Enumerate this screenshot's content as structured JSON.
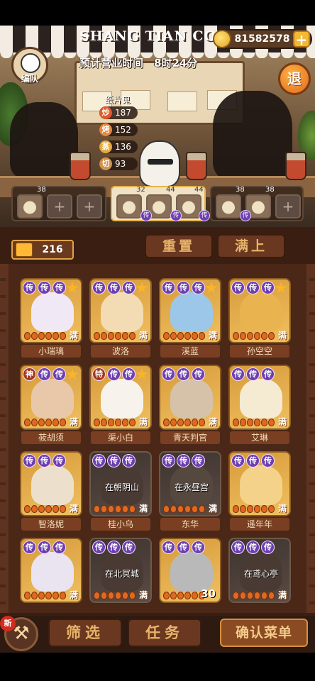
{
  "header": {
    "shop_name": "SHANG TIAN COF",
    "coins": "81582578",
    "coin_plus": "+"
  },
  "hours_text": "预计营业时间　8时24分",
  "team_label": "编队",
  "exit_label": "退",
  "chef": {
    "name": "纸片鬼",
    "stats": [
      {
        "tag": "炒",
        "value": "187",
        "color": "#e0592a"
      },
      {
        "tag": "烤",
        "value": "152",
        "color": "#e9863a"
      },
      {
        "tag": "蒸",
        "value": "136",
        "color": "#e5a93b"
      },
      {
        "tag": "切",
        "value": "93",
        "color": "#d4914a"
      }
    ]
  },
  "dish_groups": [
    {
      "num": "38",
      "plus1": "+",
      "plus2": "+"
    },
    {
      "nums": [
        "32",
        "44",
        "44"
      ],
      "badge": "传"
    },
    {
      "nums": [
        "38",
        "38"
      ],
      "plus": "+",
      "badge": "传"
    }
  ],
  "ticket_value": "216",
  "buttons": {
    "reset": "重置",
    "fill": "满上",
    "filter": "筛选",
    "task": "任务",
    "confirm": "确认菜单",
    "new": "新",
    "hammer": "⚒"
  },
  "cards": [
    {
      "name": "小瑞璃",
      "badges": [
        "传",
        "传",
        "传"
      ],
      "star": true,
      "full": "满",
      "pips": 6,
      "dim": false,
      "portrait": "#f1e8f6"
    },
    {
      "name": "波洛",
      "badges": [
        "传",
        "传",
        "传"
      ],
      "star": true,
      "full": "满",
      "pips": 6,
      "dim": false,
      "portrait": "#f3dcb3"
    },
    {
      "name": "溪蓝",
      "badges": [
        "传",
        "传",
        "传"
      ],
      "star": true,
      "full": "满",
      "pips": 6,
      "dim": false,
      "portrait": "#9cc7e8"
    },
    {
      "name": "孙空空",
      "badges": [
        "传",
        "传",
        "传"
      ],
      "star": true,
      "full": "满",
      "pips": 6,
      "dim": false,
      "portrait": "#e9b34f"
    },
    {
      "name": "莜胡须",
      "badges": [
        "神",
        "传",
        "传"
      ],
      "star": true,
      "full": "满",
      "pips": 6,
      "dim": false,
      "portrait": "#e8c8a8"
    },
    {
      "name": "渠小白",
      "badges": [
        "特",
        "传",
        "传"
      ],
      "star": true,
      "full": "满",
      "pips": 6,
      "dim": false,
      "portrait": "#f7f3ec"
    },
    {
      "name": "青天判官",
      "badges": [
        "传",
        "传",
        "传"
      ],
      "star": false,
      "full": "满",
      "pips": 6,
      "dim": false,
      "portrait": "#d6c2a8"
    },
    {
      "name": "艾琳",
      "badges": [
        "传",
        "传",
        "传"
      ],
      "star": false,
      "full": "满",
      "pips": 6,
      "dim": false,
      "portrait": "#f5ead2"
    },
    {
      "name": "智洛妮",
      "badges": [
        "传",
        "传",
        "传"
      ],
      "star": false,
      "full": "满",
      "pips": 6,
      "dim": false,
      "portrait": "#ece0cc"
    },
    {
      "name": "桂小乌",
      "badges": [
        "传",
        "传",
        "传"
      ],
      "star": false,
      "full": "满",
      "pips": 6,
      "dim": true,
      "loc": "在朝阴山",
      "portrait": "#4a3a34"
    },
    {
      "name": "东华",
      "badges": [
        "传",
        "传",
        "传"
      ],
      "star": false,
      "full": "满",
      "pips": 6,
      "dim": true,
      "loc": "在永昼宫",
      "portrait": "#55483f"
    },
    {
      "name": "遥年年",
      "badges": [
        "传",
        "传",
        "传"
      ],
      "star": false,
      "full": "满",
      "pips": 6,
      "dim": false,
      "portrait": "#f4d28a"
    },
    {
      "name": "",
      "badges": [
        "传",
        "传",
        "传"
      ],
      "star": false,
      "full": "满",
      "pips": 6,
      "dim": false,
      "portrait": "#e9e4ef"
    },
    {
      "name": "",
      "badges": [
        "传",
        "传",
        "传"
      ],
      "star": false,
      "full": "满",
      "pips": 6,
      "dim": true,
      "loc": "在北冥城",
      "portrait": "#4a3a34"
    },
    {
      "name": "",
      "badges": [
        "传",
        "传",
        "传"
      ],
      "star": false,
      "full": "",
      "pips": 6,
      "dim": false,
      "lvl": "30",
      "portrait": "#b9b9b9"
    },
    {
      "name": "",
      "badges": [
        "传",
        "传",
        "传"
      ],
      "star": false,
      "full": "满",
      "pips": 6,
      "dim": true,
      "loc": "在鸢心亭",
      "portrait": "#4a3a34"
    }
  ]
}
